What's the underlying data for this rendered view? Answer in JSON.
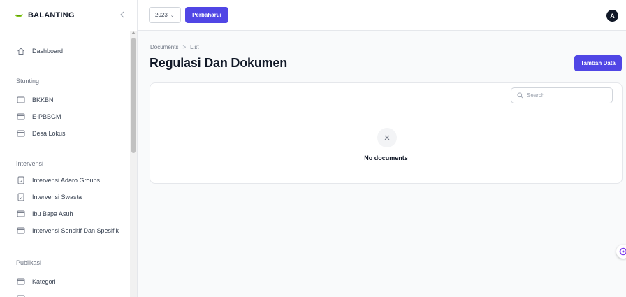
{
  "brand": {
    "name": "BALANTING",
    "collapse_icon": "chevron-left-icon"
  },
  "topbar": {
    "year": "2023",
    "update_label": "Perbaharui",
    "avatar_initial": "A"
  },
  "sidebar": {
    "dashboard": {
      "label": "Dashboard",
      "icon": "home-icon"
    },
    "groups": [
      {
        "title": "Stunting",
        "items": [
          {
            "label": "BKKBN",
            "icon": "folder-icon"
          },
          {
            "label": "E-PBBGM",
            "icon": "folder-icon"
          },
          {
            "label": "Desa Lokus",
            "icon": "folder-icon"
          }
        ]
      },
      {
        "title": "Intervensi",
        "items": [
          {
            "label": "Intervensi Adaro Groups",
            "icon": "document-icon"
          },
          {
            "label": "Intervensi Swasta",
            "icon": "document-icon"
          },
          {
            "label": "Ibu Bapa Asuh",
            "icon": "folder-icon"
          },
          {
            "label": "Intervensi Sensitif Dan Spesifik",
            "icon": "folder-icon"
          }
        ]
      },
      {
        "title": "Publikasi",
        "items": [
          {
            "label": "Kategori",
            "icon": "folder-icon"
          }
        ]
      }
    ]
  },
  "main": {
    "breadcrumb": [
      "Documents",
      "List"
    ],
    "title": "Regulasi Dan Dokumen",
    "add_label": "Tambah Data",
    "search_placeholder": "Search",
    "empty_text": "No documents"
  },
  "colors": {
    "primary": "#5046e5",
    "float_accent": "#7c3aed"
  }
}
